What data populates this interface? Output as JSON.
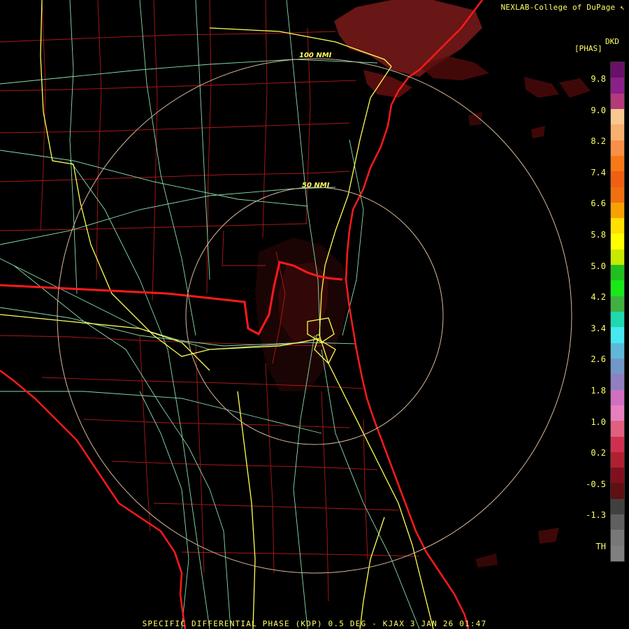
{
  "header": {
    "credit": "NEXLAB-College of DuPage ↖"
  },
  "legend": {
    "product_code": "DKD",
    "units": "[PHAS]",
    "ticks": [
      "9.8",
      "9.0",
      "8.2",
      "7.4",
      "6.6",
      "5.8",
      "5.0",
      "4.2",
      "3.4",
      "2.6",
      "1.8",
      "1.0",
      "0.2",
      "-0.5",
      "-1.3",
      "TH"
    ],
    "swatches": [
      "#6a106a",
      "#8a208a",
      "#b43a7a",
      "#f8c890",
      "#f8b070",
      "#f89048",
      "#f87818",
      "#f06010",
      "#f07010",
      "#f8a000",
      "#ffe000",
      "#ffff00",
      "#c8e800",
      "#20c020",
      "#18e818",
      "#40b040",
      "#20d8b0",
      "#48e8f0",
      "#60b8d8",
      "#7098c8",
      "#9080c0",
      "#d070c0",
      "#e880c0",
      "#e06080",
      "#d03050",
      "#b02030",
      "#801020",
      "#601010",
      "#404040",
      "#606060",
      "#787878",
      "#808080"
    ]
  },
  "range_rings": [
    {
      "label": "50 NMI"
    },
    {
      "label": "100 NMI"
    }
  ],
  "caption": "SPECIFIC DIFFERENTIAL PHASE (KDP) 0.5 DEG - KJAX 3 JAN 26 01:47",
  "colors": {
    "state_border": "#ff1a1a",
    "county_lines": "#b01818",
    "interstates": "#ffff55",
    "highways": "#88ddaa",
    "range_rings": "#d8b898",
    "echo": "#7a0e0e"
  },
  "icons": [
    "radar-site-marker-icon"
  ]
}
